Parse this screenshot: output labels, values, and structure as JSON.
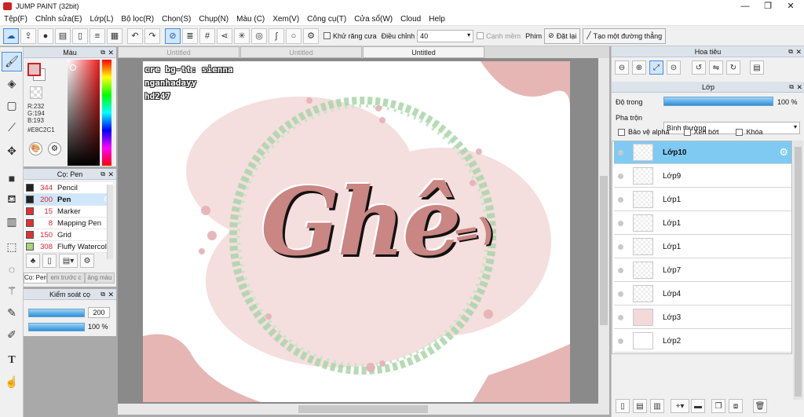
{
  "app": {
    "title": "JUMP PAINT (32bit)",
    "minimize": "—",
    "maximize": "❐",
    "close": "✕"
  },
  "menu": [
    "Tệp(F)",
    "Chỉnh sửa(E)",
    "Lớp(L)",
    "Bộ lọc(R)",
    "Chọn(S)",
    "Chụp(N)",
    "Màu (C)",
    "Xem(V)",
    "Công cụ(T)",
    "Cửa sổ(W)",
    "Cloud",
    "Help"
  ],
  "toolbar": {
    "antialias_label": "Khử răng cưa",
    "correction_label": "Điều chỉnh",
    "correction_value": "40",
    "edge_label": "Cạnh mềm",
    "key_label": "Phím",
    "reset_label": "Đặt lại",
    "line_label": "Tạo một đường thẳng"
  },
  "color_panel": {
    "title": "Màu",
    "r": "R:232",
    "g": "G:194",
    "b": "B:193",
    "hex": "#E8C2C1",
    "fg_color": "#e8c2c1"
  },
  "brush_panel": {
    "title": "Cọ: Pen",
    "items": [
      {
        "size": "344",
        "name": "Pencil",
        "color": "#222222"
      },
      {
        "size": "200",
        "name": "Pen",
        "color": "#222222"
      },
      {
        "size": "15",
        "name": "Marker",
        "color": "#e03030"
      },
      {
        "size": "8",
        "name": "Mapping Pen",
        "color": "#e03030"
      },
      {
        "size": "150",
        "name": "Grid",
        "color": "#e03030"
      },
      {
        "size": "308",
        "name": "Fluffy Watercol",
        "color": "#a7d47a"
      }
    ],
    "tabs": [
      "Cọ: Pen",
      "em trước c",
      "ảng màu"
    ]
  },
  "control_panel": {
    "title": "Kiểm soát cọ",
    "size_value": "200",
    "opacity_value": "100 %"
  },
  "tabs": [
    "Untitled",
    "Untitled",
    "Untitled"
  ],
  "canvas": {
    "credit_lines": [
      "cre bg-tt: sienna",
      "nganhadayy",
      "hd247"
    ],
    "art_text": "Ghê",
    "art_suffix": "=)"
  },
  "navigator": {
    "title": "Hoa tiêu"
  },
  "layer_panel": {
    "title": "Lớp",
    "opacity_label": "Độ trong",
    "opacity_value": "100 %",
    "blend_label": "Pha trộn",
    "blend_value": "Bình thường",
    "protect_alpha": "Bảo vệ alpha",
    "clip": "Xén bớt",
    "lock": "Khóa",
    "layers": [
      "Lớp10",
      "Lớp9",
      "Lớp1",
      "Lớp1",
      "Lớp1",
      "Lớp7",
      "Lớp4",
      "Lớp3",
      "Lớp2"
    ]
  }
}
